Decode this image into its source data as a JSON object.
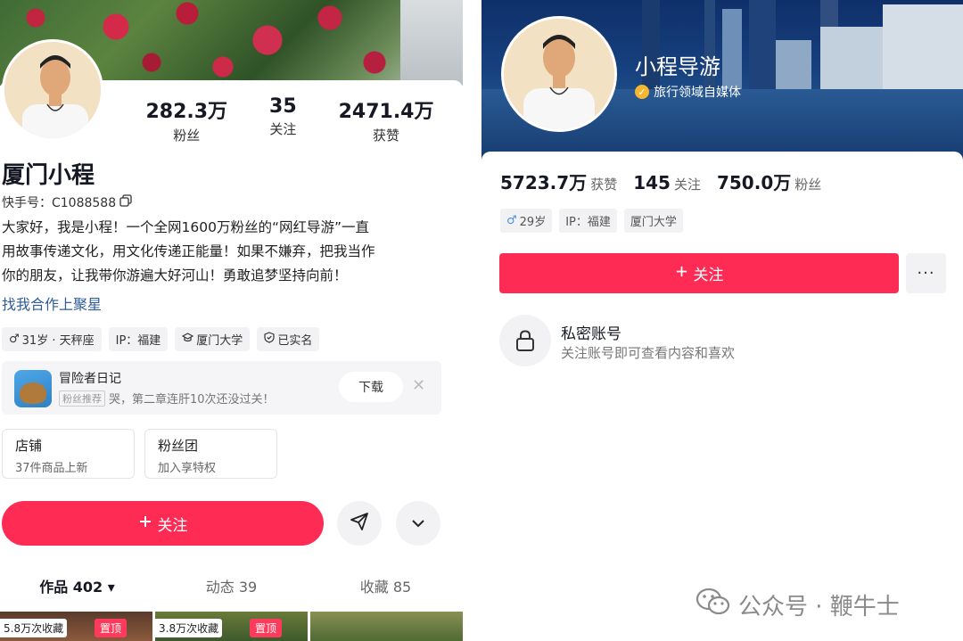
{
  "left_profile": {
    "stats": [
      {
        "value": "282.3万",
        "label": "粉丝"
      },
      {
        "value": "35",
        "label": "关注"
      },
      {
        "value": "2471.4万",
        "label": "获赞"
      }
    ],
    "name": "厦门小程",
    "account_id": "快手号：C1088588",
    "bio_lines": [
      "大家好，我是小程！一个全网1600万粉丝的“网红导游”一直",
      "用故事传递文化，用文化传递正能量！如果不嫌弃，把我当作",
      "你的朋友，让我带你游遍大好河山！勇敢追梦坚持向前！"
    ],
    "coop_link": "找我合作上聚星",
    "tags": [
      "31岁 · 天秤座",
      "IP：福建",
      "厦门大学",
      "已实名"
    ],
    "game_ad": {
      "title": "冒险者日记",
      "badge": "粉丝推荐",
      "text": "哭，第二章连肝10次还没过关！",
      "download": "下载",
      "close": "✕"
    },
    "boxes": [
      {
        "title": "店铺",
        "sub": "37件商品上新"
      },
      {
        "title": "粉丝团",
        "sub": "加入享特权"
      }
    ],
    "follow_label": "关注",
    "tabs": [
      {
        "label": "作品 402 ▾"
      },
      {
        "label": "动态 39"
      },
      {
        "label": "收藏 85"
      }
    ],
    "thumbs": [
      {
        "count": "5.8万次收藏",
        "pin": "置顶"
      },
      {
        "count": "3.8万次收藏",
        "pin": "置顶"
      }
    ]
  },
  "right_profile": {
    "name": "小程导游",
    "verify": "旅行领域自媒体",
    "stats": [
      {
        "value": "5723.7万",
        "label": "获赞"
      },
      {
        "value": "145",
        "label": "关注"
      },
      {
        "value": "750.0万",
        "label": "粉丝"
      }
    ],
    "tags": [
      "29岁",
      "IP：福建",
      "厦门大学"
    ],
    "gender_symbol": "♂",
    "follow_label": "关注",
    "more_label": "···",
    "private_title": "私密账号",
    "private_sub": "关注账号即可查看内容和喜欢"
  },
  "watermark": "公众号 · 鞭牛士",
  "colors": {
    "accent": "#fe2c55",
    "link": "#2e5c9a",
    "verify_badge": "#f5b630"
  },
  "icons": [
    "copy-icon",
    "male-icon",
    "cap-icon",
    "shield-icon",
    "plus-icon",
    "send-icon",
    "chevron-down-icon",
    "lock-icon",
    "wechat-icon"
  ]
}
